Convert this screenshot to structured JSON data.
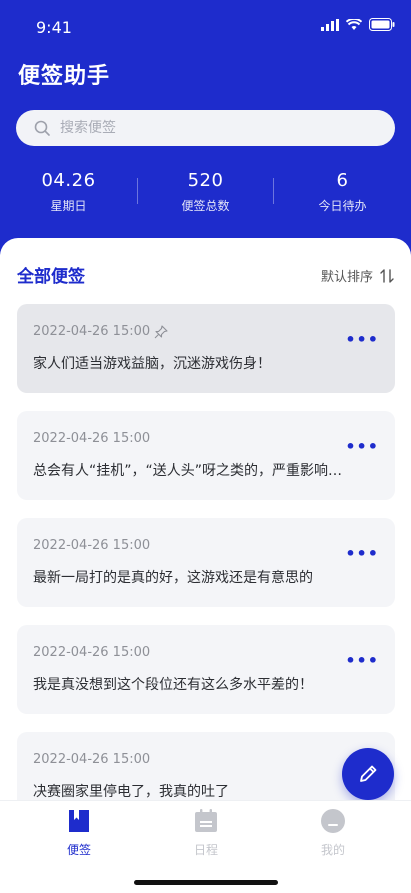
{
  "status_bar": {
    "time": "9:41"
  },
  "header": {
    "title": "便签助手"
  },
  "search": {
    "placeholder": "搜索便签"
  },
  "stats": [
    {
      "value": "04.26",
      "label": "星期日"
    },
    {
      "value": "520",
      "label": "便签总数"
    },
    {
      "value": "6",
      "label": "今日待办"
    }
  ],
  "list": {
    "title": "全部便签",
    "sort_label": "默认排序",
    "notes": [
      {
        "date": "2022-04-26  15:00",
        "text": "家人们适当游戏益脑，沉迷游戏伤身！",
        "pinned": true
      },
      {
        "date": "2022-04-26  15:00",
        "text": "总会有人“挂机”，“送人头”呀之类的，严重影响…",
        "pinned": false
      },
      {
        "date": "2022-04-26  15:00",
        "text": "最新一局打的是真的好，这游戏还是有意思的",
        "pinned": false
      },
      {
        "date": "2022-04-26  15:00",
        "text": "我是真没想到这个段位还有这么多水平差的！",
        "pinned": false
      },
      {
        "date": "2022-04-26  15:00",
        "text": "决赛圈家里停电了，我真的吐了",
        "pinned": false
      }
    ],
    "more_label": "•••"
  },
  "tabbar": {
    "items": [
      {
        "label": "便签",
        "icon": "note-icon",
        "active": true
      },
      {
        "label": "日程",
        "icon": "calendar-icon",
        "active": false
      },
      {
        "label": "我的",
        "icon": "profile-icon",
        "active": false
      }
    ]
  },
  "colors": {
    "brand": "#1e2ccc",
    "inactive": "#c4c6cc"
  }
}
